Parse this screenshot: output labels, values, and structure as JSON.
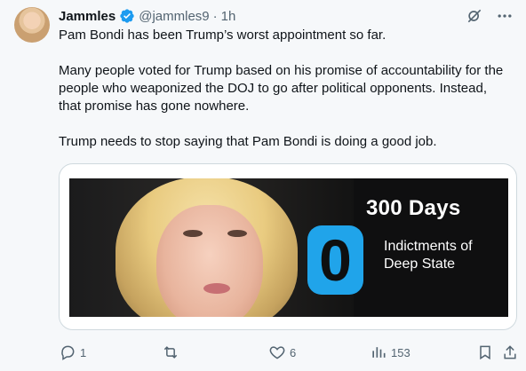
{
  "author": {
    "name": "Jammles",
    "handle": "@jammles9",
    "separator": "·",
    "time": "1h"
  },
  "tweet": {
    "text": "Pam Bondi has been Trump’s worst appointment so far.\n\nMany people voted for Trump based on his promise of accountability for the people who weaponized the DOJ to go after political opponents. Instead, that promise has gone nowhere.\n\nTrump needs to stop saying that Pam Bondi is doing a good job."
  },
  "media": {
    "headline": "300 Days",
    "big_number": "0",
    "subtitle": "Indictments of Deep State"
  },
  "actions": {
    "reply_count": "1",
    "retweet_count": "",
    "like_count": "6",
    "view_count": "153"
  },
  "icons": {
    "verified": "verified-badge-icon",
    "grok": "grok-icon",
    "more": "more-icon",
    "reply": "reply-icon",
    "retweet": "retweet-icon",
    "like": "heart-icon",
    "views": "views-icon",
    "bookmark": "bookmark-icon",
    "share": "share-icon"
  },
  "colors": {
    "verified_blue": "#1d9bf0",
    "zero_blue": "#20a4ea",
    "muted_text": "#536471"
  }
}
